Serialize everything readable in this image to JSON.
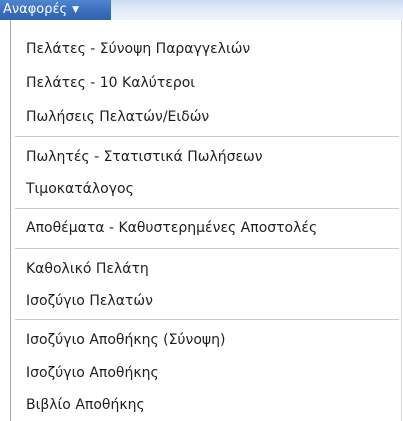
{
  "menu": {
    "title": "Αναφορές",
    "caret_icon": "▼",
    "items": [
      "Πελάτες - Σύνοψη Παραγγελιών",
      "Πελάτες - 10 Καλύτεροι",
      "Πωλήσεις Πελατών/Ειδών",
      "Πωλητές - Στατιστικά Πωλήσεων",
      "Τιμοκατάλογος",
      "Αποθέματα - Καθυστερημένες Αποστολές",
      "Καθολικό Πελάτη",
      "Ισοζύγιο Πελατών",
      "Ισοζύγιο Αποθήκης (Σύνοψη)",
      "Ισοζύγιο Αποθήκης",
      "Βιβλίο Αποθήκης"
    ]
  },
  "colors": {
    "title_bg": "#3a6fbe",
    "title_text": "#ffffff",
    "menubar_bg": "#dfe8f6",
    "item_text": "#1f1f1f",
    "separator": "#c8c8c8"
  }
}
